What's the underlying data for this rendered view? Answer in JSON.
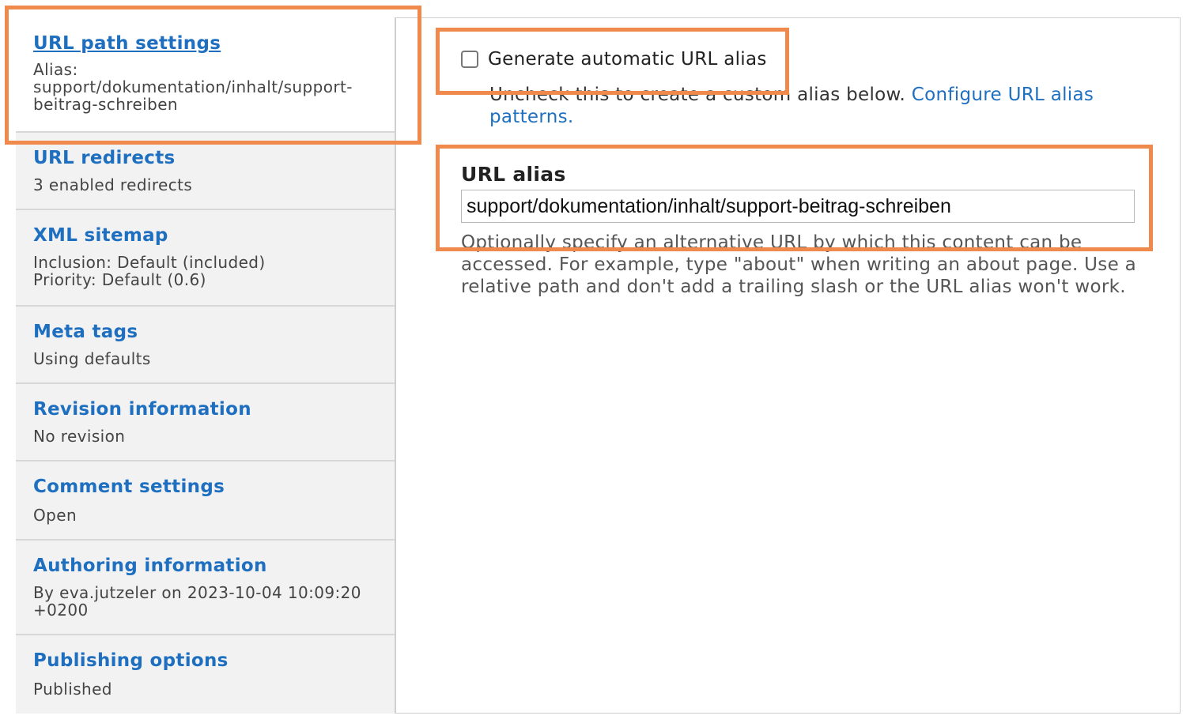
{
  "sidebar": {
    "tabs": [
      {
        "title": "URL path settings",
        "summary": "Alias:\nsupport/dokumentation/inhalt/support-\nbeitrag-schreiben"
      },
      {
        "title": "URL redirects",
        "summary": "3 enabled redirects"
      },
      {
        "title": "XML sitemap",
        "summary": "Inclusion: Default (included)\nPriority: Default (0.6)"
      },
      {
        "title": "Meta tags",
        "summary": "Using defaults"
      },
      {
        "title": "Revision information",
        "summary": "No revision"
      },
      {
        "title": "Comment settings",
        "summary": "Open"
      },
      {
        "title": "Authoring information",
        "summary": "By eva.jutzeler on 2023-10-04 10:09:20\n+0200"
      },
      {
        "title": "Publishing options",
        "summary": "Published"
      }
    ]
  },
  "main": {
    "auto_alias": {
      "label": "Generate automatic URL alias",
      "checked": false,
      "description": "Uncheck this to create a custom alias below.",
      "link_text": "Configure URL alias patterns."
    },
    "url_alias": {
      "label": "URL alias",
      "value": "support/dokumentation/inhalt/support-beitrag-schreiben",
      "description": "Optionally specify an alternative URL by which this content can be accessed. For example, type \"about\" when writing an about page. Use a relative path and don't add a trailing slash or the URL alias won't work."
    }
  },
  "colors": {
    "link": "#1f6fc0",
    "highlight": "#ef8a4c",
    "sidebar_bg": "#f2f2f2"
  }
}
